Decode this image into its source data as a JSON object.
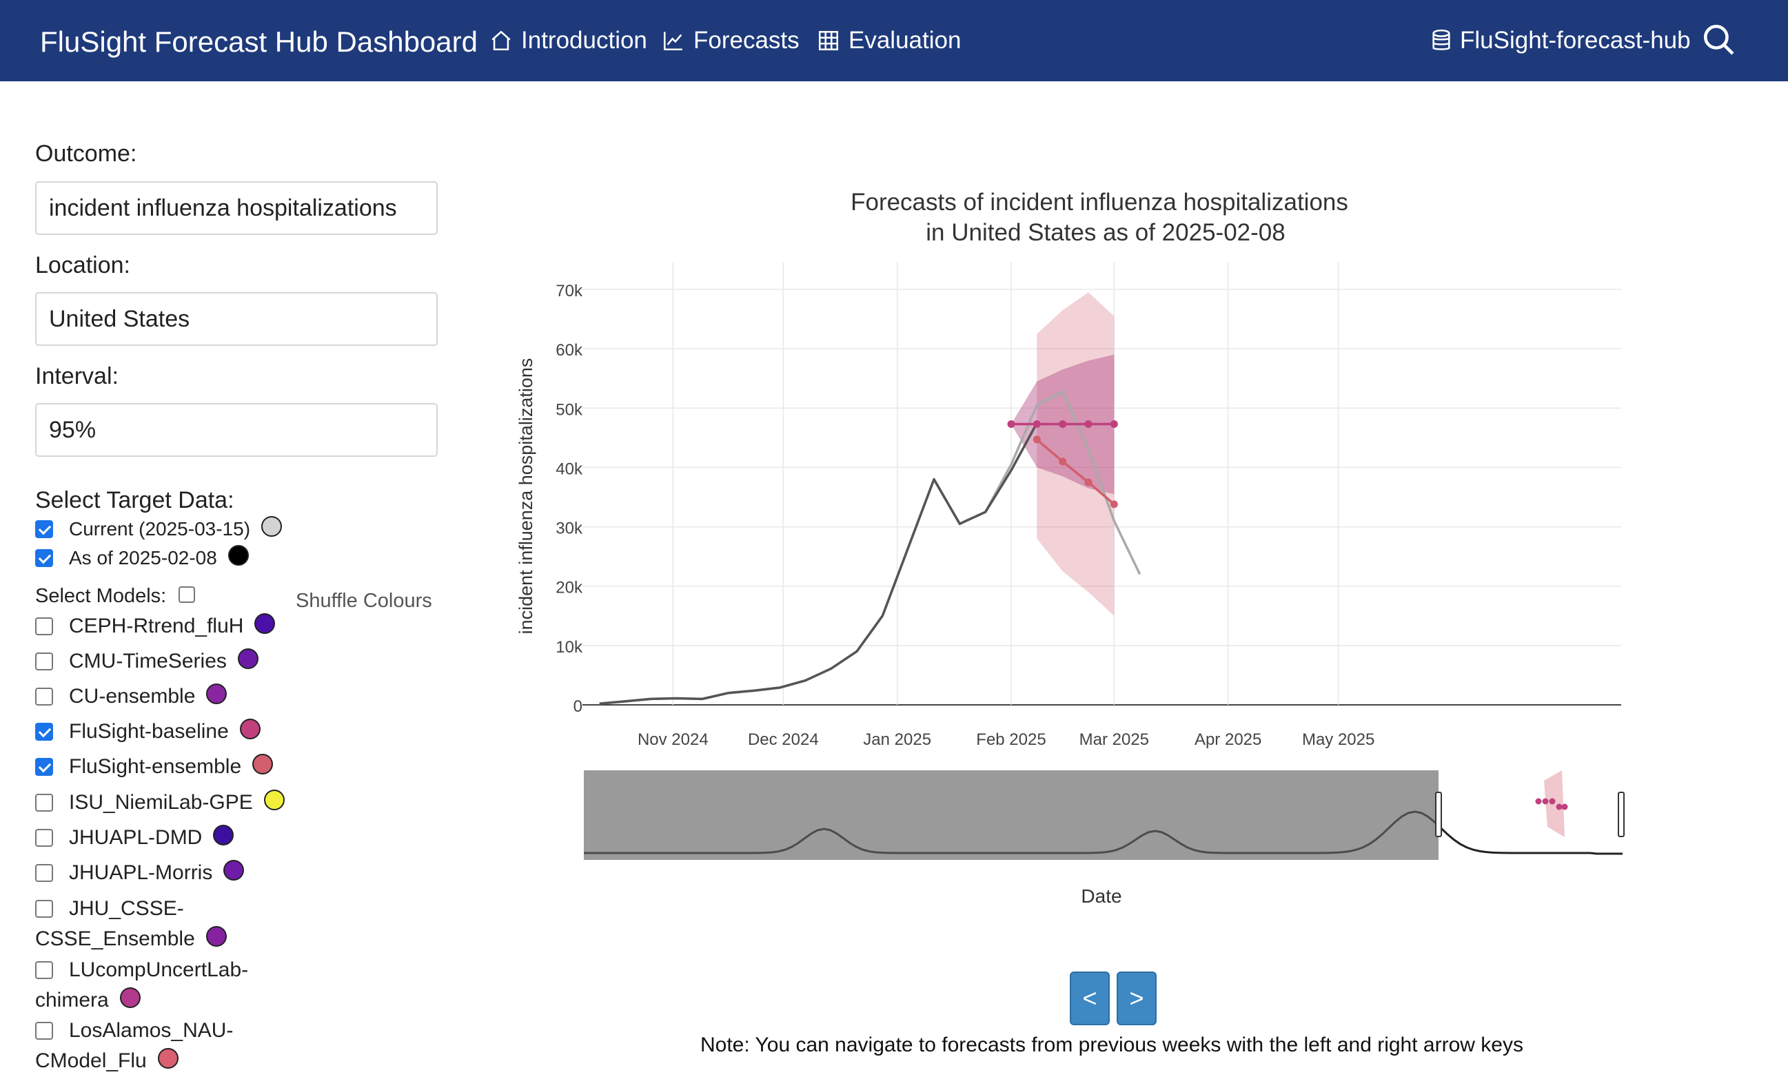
{
  "navbar": {
    "brand": "FluSight Forecast Hub Dashboard",
    "items": [
      {
        "label": "Introduction",
        "icon": "home-icon"
      },
      {
        "label": "Forecasts",
        "icon": "line-chart-icon"
      },
      {
        "label": "Evaluation",
        "icon": "table-icon"
      }
    ],
    "repo_link": "FluSight-forecast-hub",
    "search_icon": "search-icon"
  },
  "sidebar": {
    "outcome_label": "Outcome:",
    "outcome_value": "incident influenza hospitalizations",
    "location_label": "Location:",
    "location_value": "United States",
    "interval_label": "Interval:",
    "interval_value": "95%",
    "target_data_label": "Select Target Data:",
    "target_data": [
      {
        "label": "Current (2025-03-15)",
        "checked": true,
        "color": "#d3d3d3"
      },
      {
        "label": "As of 2025-02-08",
        "checked": true,
        "color": "#000000"
      }
    ],
    "select_models_label": "Select Models:",
    "shuffle_label": "Shuffle Colours",
    "models": [
      {
        "label": "CEPH-Rtrend_fluH",
        "checked": false,
        "color": "#4b10a8"
      },
      {
        "label": "CMU-TimeSeries",
        "checked": false,
        "color": "#6a1ba6"
      },
      {
        "label": "CU-ensemble",
        "checked": false,
        "color": "#8a26a0"
      },
      {
        "label": "FluSight-baseline",
        "checked": true,
        "color": "#c0407e"
      },
      {
        "label": "FluSight-ensemble",
        "checked": true,
        "color": "#d15f6e"
      },
      {
        "label": "ISU_NiemiLab-GPE",
        "checked": false,
        "color": "#f0f03a"
      },
      {
        "label": "JHUAPL-DMD",
        "checked": false,
        "color": "#3d0fa0"
      },
      {
        "label": "JHUAPL-Morris",
        "checked": false,
        "color": "#6e1ba8"
      },
      {
        "label": "JHU_CSSE-\nCSSE_Ensemble",
        "checked": false,
        "color": "#8522a0"
      },
      {
        "label": "LUcompUncertLab-\nchimera",
        "checked": false,
        "color": "#b13a8c"
      },
      {
        "label": "LosAlamos_NAU-\nCModel_Flu",
        "checked": false,
        "color": "#d86070"
      }
    ]
  },
  "chart_data": {
    "type": "line",
    "title": "Forecasts of incident influenza hospitalizations",
    "subtitle": "in United States as of 2025-02-08",
    "xlabel": "Date",
    "ylabel": "incident influenza hospitalizations",
    "ylim": [
      0,
      70000
    ],
    "yticks": [
      "0",
      "10k",
      "20k",
      "30k",
      "40k",
      "50k",
      "60k",
      "70k"
    ],
    "xticks": [
      "Nov 2024",
      "Dec 2024",
      "Jan 2025",
      "Feb 2025",
      "Mar 2025",
      "Apr 2025",
      "May 2025"
    ],
    "grid": true,
    "series": [
      {
        "name": "Current (2025-03-15)",
        "color": "#aaaaaa",
        "x": [
          "2024-10-12",
          "2024-10-19",
          "2024-10-26",
          "2024-11-02",
          "2024-11-09",
          "2024-11-16",
          "2024-11-23",
          "2024-11-30",
          "2024-12-07",
          "2024-12-14",
          "2024-12-21",
          "2024-12-28",
          "2025-01-04",
          "2025-01-11",
          "2025-01-18",
          "2025-01-25",
          "2025-02-01",
          "2025-02-08",
          "2025-02-15",
          "2025-02-22",
          "2025-03-01",
          "2025-03-08"
        ],
        "y": [
          200,
          600,
          1000,
          1100,
          1000,
          2000,
          2400,
          2900,
          4100,
          6100,
          9000,
          15000,
          26500,
          38000,
          30500,
          32500,
          40500,
          50500,
          52800,
          43000,
          31000,
          22000
        ]
      },
      {
        "name": "As of 2025-02-08",
        "color": "#555555",
        "x": [
          "2024-10-12",
          "2024-10-19",
          "2024-10-26",
          "2024-11-02",
          "2024-11-09",
          "2024-11-16",
          "2024-11-23",
          "2024-11-30",
          "2024-12-07",
          "2024-12-14",
          "2024-12-21",
          "2024-12-28",
          "2025-01-04",
          "2025-01-11",
          "2025-01-18",
          "2025-01-25",
          "2025-02-01",
          "2025-02-08"
        ],
        "y": [
          200,
          600,
          1000,
          1100,
          1000,
          2000,
          2400,
          2900,
          4100,
          6100,
          9000,
          15000,
          26500,
          38000,
          30500,
          32500,
          39500,
          47500
        ]
      },
      {
        "name": "FluSight-baseline",
        "color": "#c0407e",
        "x": [
          "2025-02-01",
          "2025-02-08",
          "2025-02-15",
          "2025-02-22",
          "2025-03-01"
        ],
        "y": [
          47300,
          47300,
          47300,
          47300,
          47300
        ],
        "lower": [
          47300,
          40000,
          38500,
          36500,
          35500
        ],
        "upper": [
          47300,
          54500,
          56500,
          58000,
          59000
        ]
      },
      {
        "name": "FluSight-ensemble",
        "color": "#d15f6e",
        "x": [
          "2025-02-08",
          "2025-02-15",
          "2025-02-22",
          "2025-03-01"
        ],
        "y": [
          44700,
          41000,
          37500,
          33800
        ],
        "lower": [
          28000,
          22500,
          19000,
          15000
        ],
        "upper": [
          62500,
          66500,
          69500,
          65500
        ]
      }
    ]
  },
  "buttons": {
    "prev": "<",
    "next": ">"
  },
  "note": "Note: You can navigate to forecasts from previous weeks with the left and right arrow keys"
}
